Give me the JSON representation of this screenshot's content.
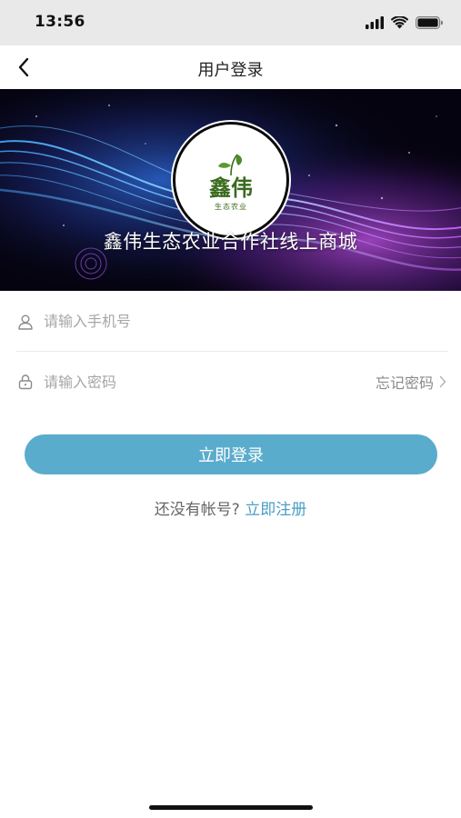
{
  "status_bar": {
    "time": "13:56"
  },
  "nav": {
    "title": "用户登录"
  },
  "banner": {
    "logo_text": "鑫伟",
    "logo_subtext": "生态农业",
    "title": "鑫伟生态农业合作社线上商城"
  },
  "form": {
    "phone_placeholder": "请输入手机号",
    "phone_value": "",
    "password_placeholder": "请输入密码",
    "password_value": "",
    "forgot_password": "忘记密码"
  },
  "login_button": "立即登录",
  "register": {
    "prompt": "还没有帐号?",
    "link": "立即注册"
  },
  "colors": {
    "accent": "#5aaccc",
    "link": "#4a9dc5",
    "logo_green": "#3a6b1e",
    "status_bar_bg": "#e9e9e9"
  },
  "icons": [
    "signal-icon",
    "wifi-icon",
    "battery-icon",
    "back-arrow-icon",
    "user-icon",
    "lock-icon",
    "chevron-right-icon",
    "tea-leaf-icon"
  ]
}
